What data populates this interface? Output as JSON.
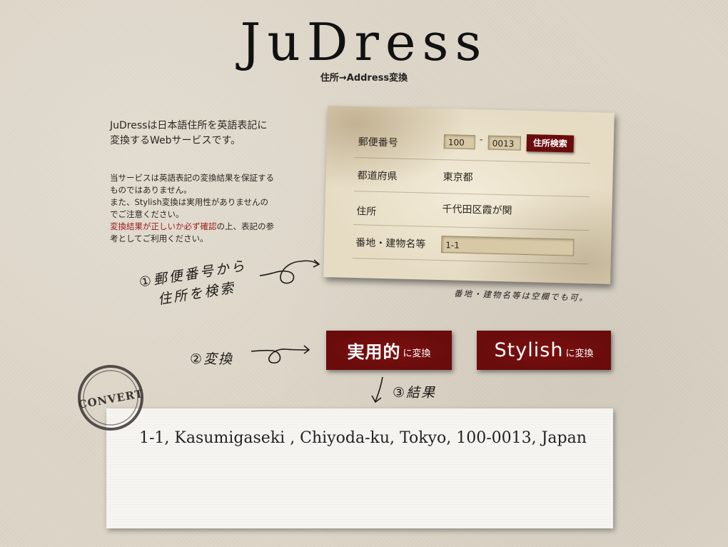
{
  "header": {
    "logo": "JuDress",
    "subtitle": "住所→Address変換"
  },
  "intro": {
    "text_line1": "JuDressは日本語住所を英語表記に",
    "text_line2": "変換するWebサービスです。"
  },
  "notice": {
    "line1": "当サービスは英語表記の変換結果を保証する",
    "line2": "ものではありません。",
    "line3": "また、Stylish変換は実用性がありませんの",
    "line4": "でご注意ください。",
    "line5_warn": "変換結果が正しいか必ず確認",
    "line5_rest": "の上、表記の参",
    "line6": "考としてご利用ください。"
  },
  "form": {
    "postal": {
      "label": "郵便番号",
      "first": "100",
      "dash": "-",
      "second": "0013",
      "search_label": "住所検索"
    },
    "prefecture": {
      "label": "都道府県",
      "value": "東京都"
    },
    "address": {
      "label": "住所",
      "value": "千代田区霞が関"
    },
    "building": {
      "label": "番地・建物名等",
      "value": "1-1"
    },
    "note": "番地・建物名等は空欄でも可。"
  },
  "steps": {
    "step1_line1": "①郵便番号から",
    "step1_line2": "住所を検索",
    "step2": "②変換",
    "step3": "③結果"
  },
  "buttons": {
    "practical_main": "実用的",
    "practical_sub": "に変換",
    "stylish_main": "Stylish",
    "stylish_sub": "に変換"
  },
  "stamp": {
    "text": "CONVERT"
  },
  "result": {
    "text": "1-1, Kasumigaseki , Chiyoda-ku, Tokyo, 100-0013, Japan"
  },
  "colors": {
    "background": "#ddd6c8",
    "button": "#6a0c0c",
    "warning": "#9a1a1a",
    "card": "#e6dcc4"
  }
}
